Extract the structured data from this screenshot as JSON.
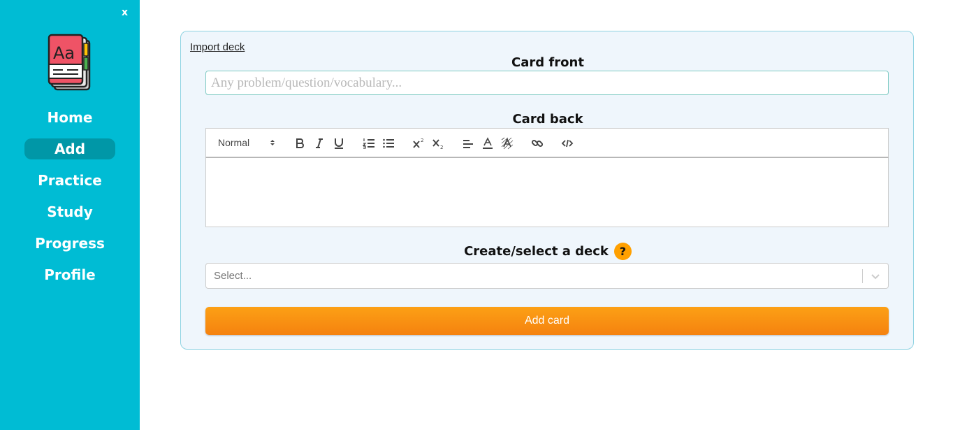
{
  "sidebar": {
    "close_label": "x",
    "items": [
      {
        "label": "Home"
      },
      {
        "label": "Add"
      },
      {
        "label": "Practice"
      },
      {
        "label": "Study"
      },
      {
        "label": "Progress"
      },
      {
        "label": "Profile"
      }
    ],
    "active_item": "Add",
    "logo": {
      "text": "Aa",
      "icon": "flashcards-logo-icon"
    }
  },
  "form": {
    "import_label": "Import deck",
    "front_label": "Card front",
    "front_placeholder": "Any problem/question/vocabulary...",
    "back_label": "Card back",
    "toolbar": {
      "format_select": "Normal",
      "buttons": [
        "bold-icon",
        "italic-icon",
        "underline-icon",
        "ordered-list-icon",
        "bullet-list-icon",
        "superscript-icon",
        "subscript-icon",
        "align-icon",
        "text-color-icon",
        "background-color-icon",
        "link-icon",
        "code-icon"
      ]
    },
    "deck_label": "Create/select a deck",
    "help_symbol": "?",
    "deck_placeholder": "Select...",
    "submit_label": "Add card"
  },
  "colors": {
    "sidebar": "#00bcd4",
    "active_nav": "#0097a7",
    "panel_bg": "#eff6fc",
    "accent_orange": "#f7900f",
    "help_badge": "#ffa000"
  }
}
